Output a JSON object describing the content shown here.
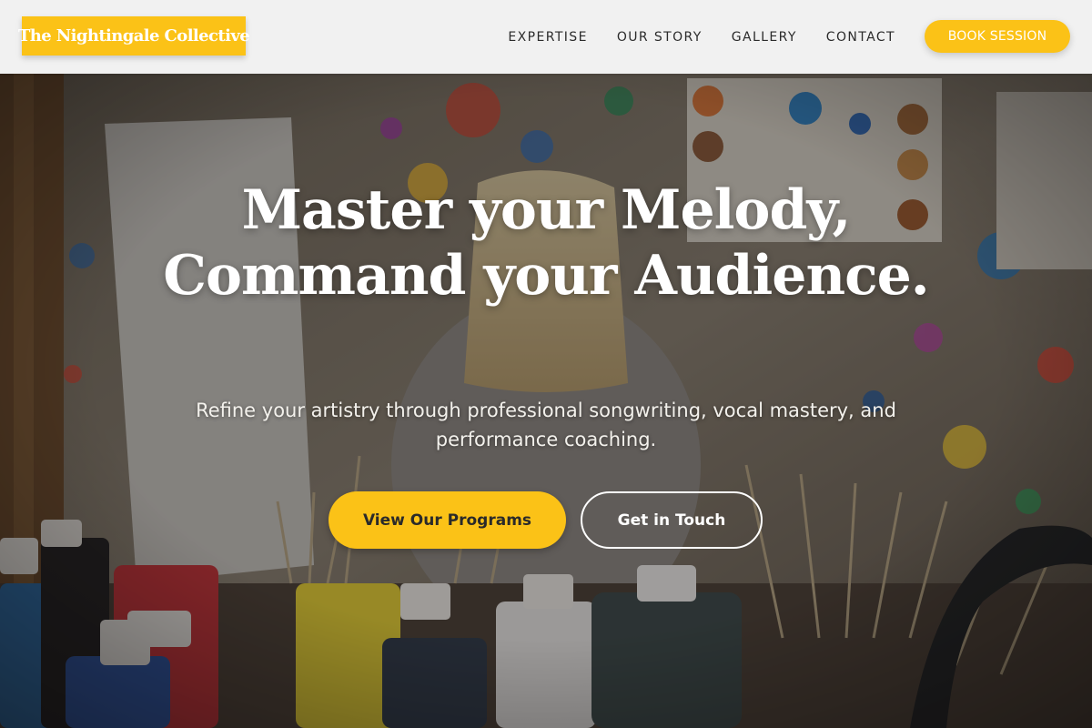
{
  "brand": {
    "name": "The Nightingale Collective",
    "accent_color": "#fbc217"
  },
  "nav": {
    "links": [
      {
        "label": "EXPERTISE"
      },
      {
        "label": "OUR STORY"
      },
      {
        "label": "GALLERY"
      },
      {
        "label": "CONTACT"
      }
    ],
    "cta_label": "BOOK SESSION"
  },
  "hero": {
    "background": "paint-studio-photo",
    "title": "Master your Melody, Command your Audience.",
    "subtitle": "Refine your artistry through professional songwriting, vocal mastery, and performance coaching.",
    "primary_cta": "View Our Programs",
    "secondary_cta": "Get in Touch"
  }
}
